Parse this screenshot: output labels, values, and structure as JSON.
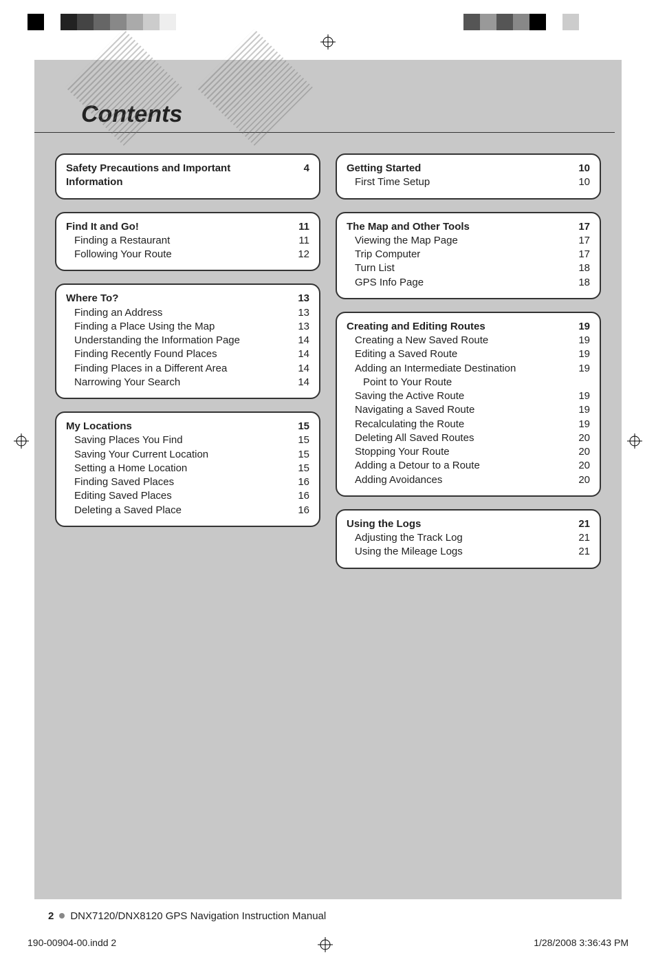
{
  "title": "Contents",
  "left": [
    {
      "head": {
        "t": "Safety Precautions and Important Information",
        "p": "4"
      },
      "items": []
    },
    {
      "head": {
        "t": "Find It and Go!",
        "p": "11"
      },
      "items": [
        {
          "t": "Finding a Restaurant",
          "p": "11"
        },
        {
          "t": "Following Your Route",
          "p": "12"
        }
      ]
    },
    {
      "head": {
        "t": "Where To?",
        "p": "13"
      },
      "items": [
        {
          "t": "Finding an Address",
          "p": "13"
        },
        {
          "t": "Finding a Place Using the Map",
          "p": "13"
        },
        {
          "t": "Understanding the Information Page",
          "p": "14"
        },
        {
          "t": "Finding Recently Found Places",
          "p": "14"
        },
        {
          "t": "Finding Places in a Different Area",
          "p": "14"
        },
        {
          "t": "Narrowing Your Search",
          "p": "14"
        }
      ]
    },
    {
      "head": {
        "t": "My Locations",
        "p": "15"
      },
      "items": [
        {
          "t": "Saving Places You Find",
          "p": "15"
        },
        {
          "t": "Saving Your Current Location",
          "p": "15"
        },
        {
          "t": "Setting a Home Location",
          "p": "15"
        },
        {
          "t": "Finding Saved Places",
          "p": "16"
        },
        {
          "t": "Editing Saved Places",
          "p": "16"
        },
        {
          "t": "Deleting a Saved Place",
          "p": "16"
        }
      ]
    }
  ],
  "right": [
    {
      "head": {
        "t": "Getting Started",
        "p": "10"
      },
      "items": [
        {
          "t": "First Time Setup",
          "p": "10"
        }
      ]
    },
    {
      "head": {
        "t": "The Map and Other Tools",
        "p": "17"
      },
      "items": [
        {
          "t": "Viewing the Map Page",
          "p": "17"
        },
        {
          "t": "Trip Computer",
          "p": "17"
        },
        {
          "t": "Turn List",
          "p": "18"
        },
        {
          "t": "GPS Info Page",
          "p": "18"
        }
      ]
    },
    {
      "head": {
        "t": "Creating and Editing Routes",
        "p": "19"
      },
      "items": [
        {
          "t": "Creating a New Saved Route",
          "p": "19"
        },
        {
          "t": "Editing a Saved Route",
          "p": "19"
        },
        {
          "t": "Adding an Intermediate Destination",
          "p": "19",
          "cont": "Point to Your Route"
        },
        {
          "t": "Saving the Active Route",
          "p": "19"
        },
        {
          "t": "Navigating a Saved Route",
          "p": "19"
        },
        {
          "t": "Recalculating the Route",
          "p": "19"
        },
        {
          "t": "Deleting All Saved Routes",
          "p": "20"
        },
        {
          "t": "Stopping Your Route",
          "p": "20"
        },
        {
          "t": "Adding a Detour to a Route",
          "p": "20"
        },
        {
          "t": "Adding Avoidances",
          "p": "20"
        }
      ]
    },
    {
      "head": {
        "t": "Using the Logs",
        "p": "21"
      },
      "items": [
        {
          "t": "Adjusting the Track Log",
          "p": "21"
        },
        {
          "t": "Using the Mileage Logs",
          "p": "21"
        }
      ]
    }
  ],
  "footer": {
    "page": "2",
    "title": "DNX7120/DNX8120 GPS Navigation Instruction Manual"
  },
  "slug": {
    "file": "190-00904-00.indd   2",
    "stamp": "1/28/2008   3:36:43 PM"
  },
  "bars_left": [
    "#000",
    "#fff",
    "#222",
    "#444",
    "#666",
    "#888",
    "#aaa",
    "#ccc",
    "#eee",
    "#fff",
    "#fff",
    "#fff"
  ],
  "bars_right": [
    "#fff",
    "#fff",
    "#555",
    "#999",
    "#555",
    "#888",
    "#000",
    "#fff",
    "#ccc",
    "#fff",
    "#fff",
    "#fff"
  ]
}
